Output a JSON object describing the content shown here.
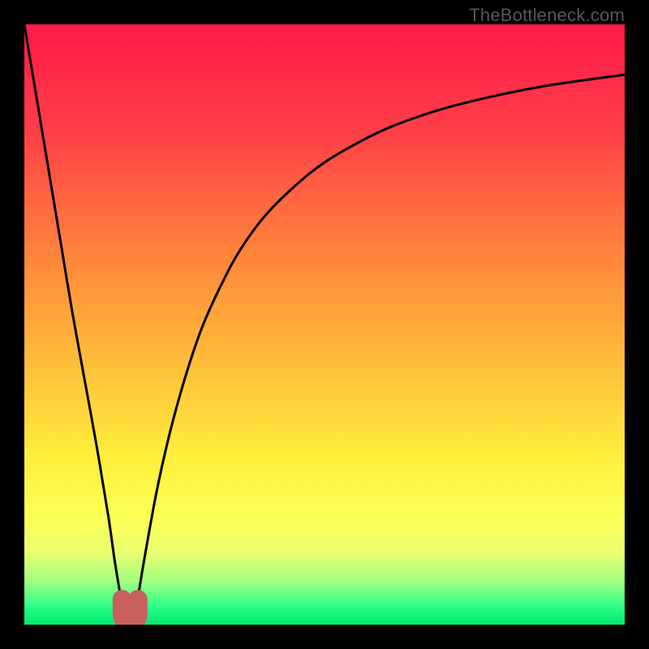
{
  "watermark": "TheBottleneck.com",
  "chart_data": {
    "type": "line",
    "title": "",
    "xlabel": "",
    "ylabel": "",
    "xlim": [
      0,
      100
    ],
    "ylim": [
      0,
      100
    ],
    "gradient_stops": [
      {
        "offset": 0,
        "color": "#ff1a4b"
      },
      {
        "offset": 18,
        "color": "#ff3f47"
      },
      {
        "offset": 40,
        "color": "#ff8a3a"
      },
      {
        "offset": 58,
        "color": "#ffc23a"
      },
      {
        "offset": 72,
        "color": "#ffee3c"
      },
      {
        "offset": 82,
        "color": "#fbff55"
      },
      {
        "offset": 88,
        "color": "#eaff70"
      },
      {
        "offset": 93,
        "color": "#9cff80"
      },
      {
        "offset": 97,
        "color": "#2bff86"
      },
      {
        "offset": 100,
        "color": "#00e86e"
      }
    ],
    "series": [
      {
        "name": "bottleneck-curve",
        "x": [
          0,
          2,
          4,
          6,
          8,
          10,
          12,
          14,
          15,
          16,
          16.8,
          17.6,
          18.4,
          19,
          20,
          22,
          24,
          26,
          28,
          30,
          33,
          36,
          40,
          45,
          50,
          56,
          62,
          70,
          78,
          86,
          94,
          100
        ],
        "values": [
          100,
          88,
          76,
          64,
          52,
          41,
          30,
          18,
          11,
          5,
          1.5,
          0.3,
          1.5,
          5,
          11,
          22,
          31,
          38.5,
          45,
          50.5,
          57,
          62.5,
          68,
          73,
          77,
          80.5,
          83.3,
          86,
          88,
          89.6,
          90.8,
          91.6
        ]
      }
    ],
    "marker": {
      "name": "bottleneck-minimum",
      "shape": "U",
      "center_x": 17.6,
      "half_width": 1.3,
      "top_y": 4.2,
      "bottom_y": 0.4,
      "color": "#c9605e",
      "stroke_width": 3.2
    }
  }
}
